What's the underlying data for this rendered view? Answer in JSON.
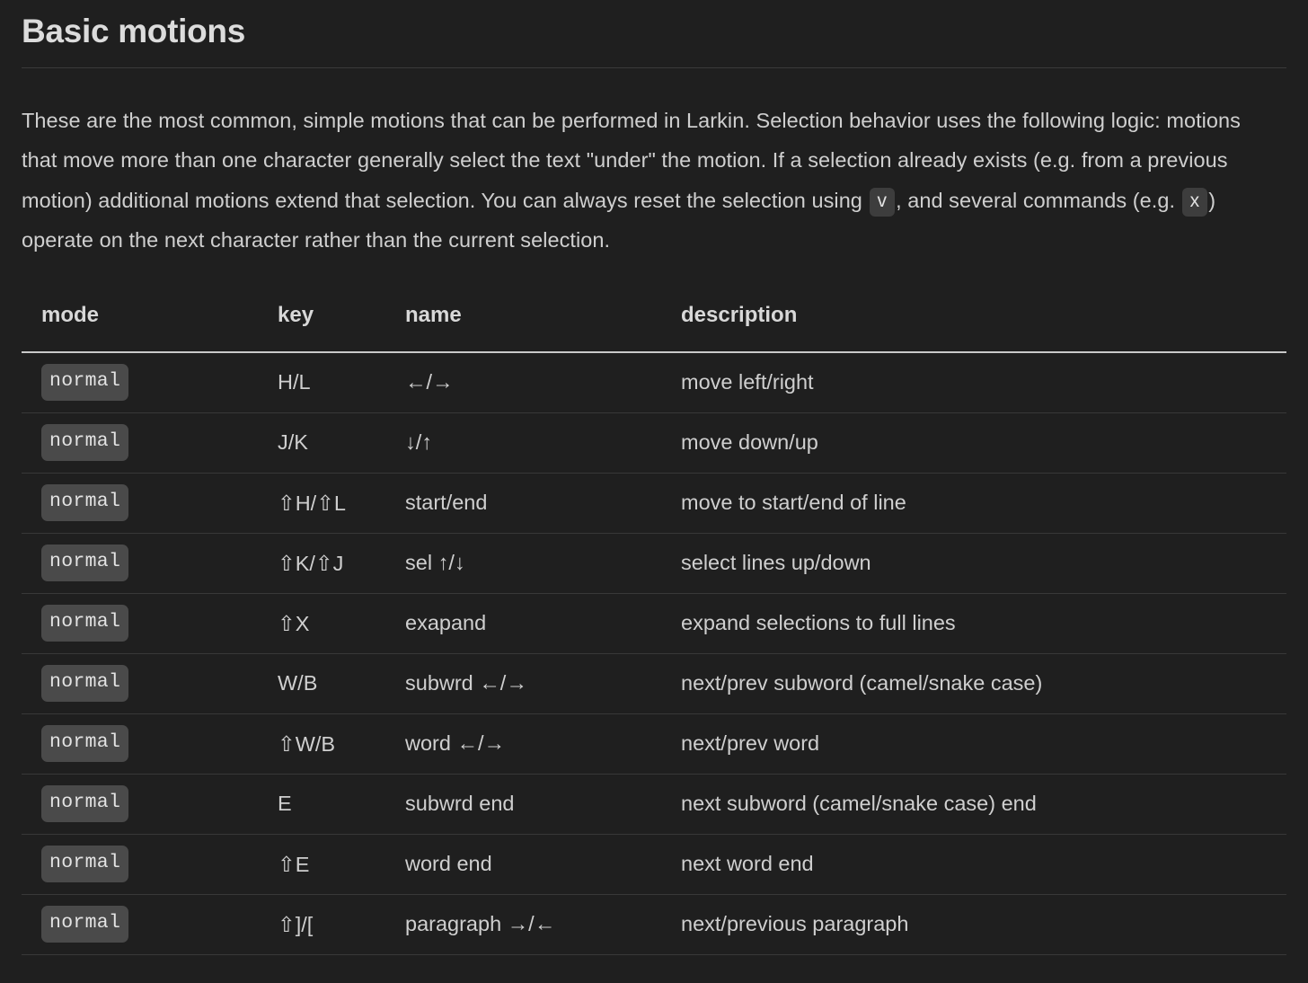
{
  "page": {
    "title": "Basic motions",
    "background_color": "#1f1f1f",
    "text_color": "#cfcfcf",
    "badge_color": "#4a4a4a"
  },
  "intro": {
    "part1": "These are the most common, simple motions that can be performed in Larkin. Selection behavior uses the following logic: motions that move more than one character generally select the text \"under\" the motion. If a selection already exists (e.g. from a previous motion) additional motions extend that selection. You can always reset the selection using ",
    "key1": "v",
    "part2": ", and several commands (e.g. ",
    "key2": "x",
    "part3": ") operate on the next character rather than the current selection."
  },
  "table": {
    "headers": {
      "mode": "mode",
      "key": "key",
      "name": "name",
      "description": "description"
    },
    "rows": [
      {
        "mode": "normal",
        "key": "H/L",
        "name": "←/→",
        "description": "move left/right"
      },
      {
        "mode": "normal",
        "key": "J/K",
        "name": "↓/↑",
        "description": "move down/up"
      },
      {
        "mode": "normal",
        "key": "⇧H/⇧L",
        "name": "start/end",
        "description": "move to start/end of line"
      },
      {
        "mode": "normal",
        "key": "⇧K/⇧J",
        "name": "sel ↑/↓",
        "description": "select lines up/down"
      },
      {
        "mode": "normal",
        "key": "⇧X",
        "name": "exapand",
        "description": "expand selections to full lines"
      },
      {
        "mode": "normal",
        "key": "W/B",
        "name": "subwrd ←/→",
        "description": "next/prev subword (camel/snake case)"
      },
      {
        "mode": "normal",
        "key": "⇧W/B",
        "name": "word ←/→",
        "description": "next/prev word"
      },
      {
        "mode": "normal",
        "key": "E",
        "name": "subwrd end",
        "description": "next subword (camel/snake case) end"
      },
      {
        "mode": "normal",
        "key": "⇧E",
        "name": "word end",
        "description": "next word end"
      },
      {
        "mode": "normal",
        "key": "⇧]/[",
        "name": "paragraph →/←",
        "description": "next/previous paragraph"
      }
    ]
  }
}
